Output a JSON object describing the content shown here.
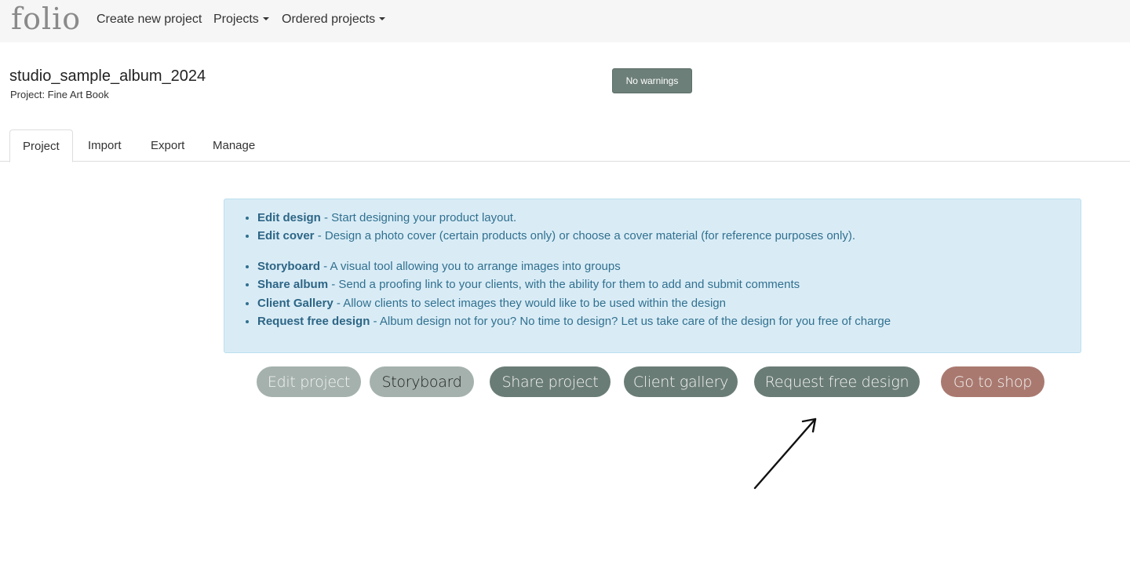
{
  "navbar": {
    "logo": "folio",
    "items": [
      {
        "label": "Create new project",
        "dropdown": false
      },
      {
        "label": "Projects",
        "dropdown": true
      },
      {
        "label": "Ordered projects",
        "dropdown": true
      }
    ]
  },
  "header": {
    "album_title": "studio_sample_album_2024",
    "project_label": "Project: Fine Art Book",
    "warnings_badge": "No warnings"
  },
  "tabs": [
    {
      "label": "Project",
      "active": true
    },
    {
      "label": "Import",
      "active": false
    },
    {
      "label": "Export",
      "active": false
    },
    {
      "label": "Manage",
      "active": false
    }
  ],
  "info": {
    "group1": [
      {
        "term": "Edit design",
        "desc": " - Start designing your product layout."
      },
      {
        "term": "Edit cover",
        "desc": " - Design a photo cover (certain products only) or choose a cover material (for reference purposes only)."
      }
    ],
    "group2": [
      {
        "term": "Storyboard",
        "desc": " - A visual tool allowing you to arrange images into groups"
      },
      {
        "term": "Share album",
        "desc": " - Send a proofing link to your clients, with the ability for them to add and submit comments"
      },
      {
        "term": "Client Gallery",
        "desc": " - Allow clients to select images they would like to be used within the design"
      },
      {
        "term": "Request free design",
        "desc": " - Album design not for you? No time to design? Let us take care of the design for you free of charge"
      }
    ]
  },
  "actions": {
    "edit_project": "Edit project",
    "storyboard": "Storyboard",
    "share_project": "Share project",
    "client_gallery": "Client gallery",
    "request_free_design": "Request free design",
    "go_to_shop": "Go to shop"
  },
  "colors": {
    "navbar_bg": "#f6f6f6",
    "badge": "#6c7f78",
    "info_bg": "#d9ecf6",
    "info_text": "#31708f",
    "btn_light": "#a4b1ad",
    "btn_dark": "#6a7c76",
    "btn_shop": "#a9796f"
  },
  "annotation": {
    "icon": "arrow-up-right-icon",
    "points_to": "Request free design"
  }
}
